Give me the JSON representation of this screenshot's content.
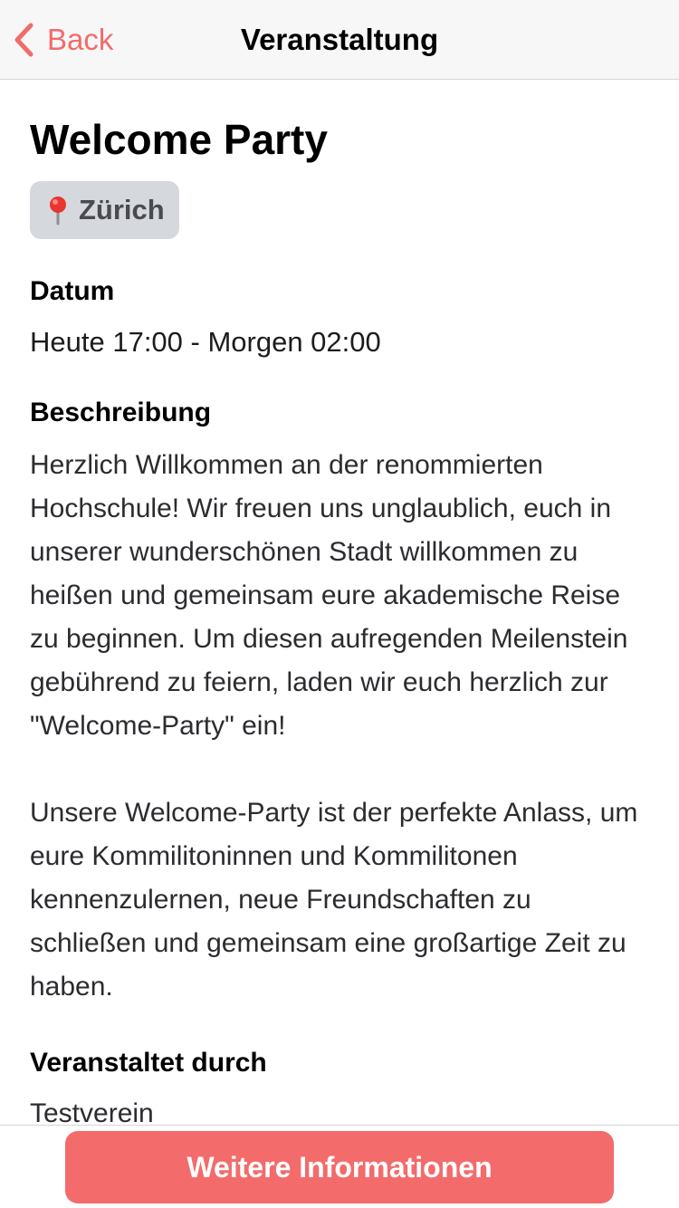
{
  "nav": {
    "back_label": "Back",
    "title": "Veranstaltung",
    "accent_color": "#f26b6b"
  },
  "event": {
    "title": "Welcome Party",
    "location": {
      "icon": "pin-icon",
      "label": "Zürich"
    },
    "date": {
      "heading": "Datum",
      "value": "Heute 17:00 - Morgen 02:00"
    },
    "description": {
      "heading": "Beschreibung",
      "paragraphs": [
        "Herzlich Willkommen an der renommierten Hochschule! Wir freuen uns unglaublich, euch in unserer wunderschönen Stadt willkommen zu heißen und gemeinsam eure akademische Reise zu beginnen. Um diesen aufregenden Meilenstein gebührend zu feiern, laden wir euch herzlich zur \"Welcome-Party\" ein!",
        "Unsere Welcome-Party ist der perfekte Anlass, um eure Kommilitoninnen und Kommilitonen kennenzulernen, neue Freundschaften zu schließen und gemeinsam eine großartige Zeit zu haben."
      ]
    },
    "organizer": {
      "heading": "Veranstaltet durch",
      "value": "Testverein"
    }
  },
  "footer": {
    "button_label": "Weitere Informationen",
    "button_color": "#f36b6b"
  }
}
